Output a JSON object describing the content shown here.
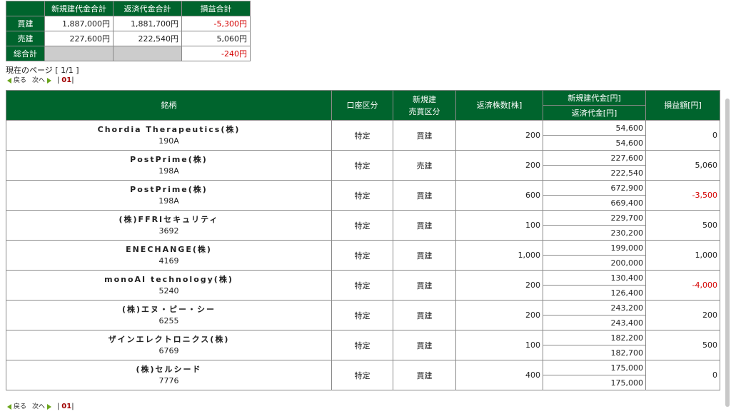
{
  "summary": {
    "headers": [
      "",
      "新規建代金合計",
      "返済代金合計",
      "損益合計"
    ],
    "rows": [
      {
        "label": "買建",
        "new": "1,887,000円",
        "repay": "1,881,700円",
        "pl": "-5,300円",
        "neg": true
      },
      {
        "label": "売建",
        "new": "227,600円",
        "repay": "222,540円",
        "pl": "5,060円",
        "neg": false
      }
    ],
    "total": {
      "label": "総合計",
      "pl": "-240円"
    }
  },
  "page_info": "現在のページ [ 1/1 ]",
  "pager": {
    "prev": "戻る",
    "next": "次へ",
    "sep1": "|",
    "page": "01",
    "sep2": "|"
  },
  "table": {
    "headers": {
      "name": "銘柄",
      "account": "口座区分",
      "trade_line1": "新規建",
      "trade_line2": "売買区分",
      "qty": "返済株数[株]",
      "new_amount": "新規建代金[円]",
      "repay_amount": "返済代金[円]",
      "pl": "損益額[円]"
    },
    "rows": [
      {
        "name": "Chordia Therapeutics(株)",
        "code": "190A",
        "account": "特定",
        "trade": "買建",
        "qty": "200",
        "new": "54,600",
        "repay": "54,600",
        "pl": "0",
        "neg": false
      },
      {
        "name": "PostPrime(株)",
        "code": "198A",
        "account": "特定",
        "trade": "売建",
        "qty": "200",
        "new": "227,600",
        "repay": "222,540",
        "pl": "5,060",
        "neg": false
      },
      {
        "name": "PostPrime(株)",
        "code": "198A",
        "account": "特定",
        "trade": "買建",
        "qty": "600",
        "new": "672,900",
        "repay": "669,400",
        "pl": "-3,500",
        "neg": true
      },
      {
        "name": "(株)FFRIセキュリティ",
        "code": "3692",
        "account": "特定",
        "trade": "買建",
        "qty": "100",
        "new": "229,700",
        "repay": "230,200",
        "pl": "500",
        "neg": false
      },
      {
        "name": "ENECHANGE(株)",
        "code": "4169",
        "account": "特定",
        "trade": "買建",
        "qty": "1,000",
        "new": "199,000",
        "repay": "200,000",
        "pl": "1,000",
        "neg": false
      },
      {
        "name": "monoAI technology(株)",
        "code": "5240",
        "account": "特定",
        "trade": "買建",
        "qty": "200",
        "new": "130,400",
        "repay": "126,400",
        "pl": "-4,000",
        "neg": true
      },
      {
        "name": "(株)エヌ・ピー・シー",
        "code": "6255",
        "account": "特定",
        "trade": "買建",
        "qty": "200",
        "new": "243,200",
        "repay": "243,400",
        "pl": "200",
        "neg": false
      },
      {
        "name": "ザインエレクトロニクス(株)",
        "code": "6769",
        "account": "特定",
        "trade": "買建",
        "qty": "100",
        "new": "182,200",
        "repay": "182,700",
        "pl": "500",
        "neg": false
      },
      {
        "name": "(株)セルシード",
        "code": "7776",
        "account": "特定",
        "trade": "買建",
        "qty": "400",
        "new": "175,000",
        "repay": "175,000",
        "pl": "0",
        "neg": false
      }
    ]
  },
  "colors": {
    "header_green": "#00642d",
    "negative": "#d40000",
    "pager_arrow": "#6aa51c"
  }
}
